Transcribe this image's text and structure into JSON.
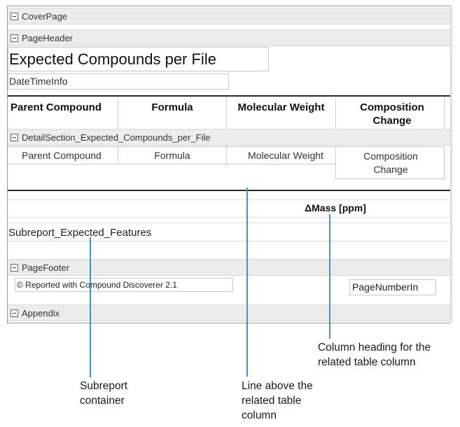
{
  "bands": {
    "cover_page": "CoverPage",
    "page_header": "PageHeader",
    "detail_section": "DetailSection_Expected_Compounds_per_File",
    "page_footer": "PageFooter",
    "appendix": "Appendix"
  },
  "header": {
    "title": "Expected Compounds per File",
    "datetime": "DateTimeInfo"
  },
  "table_headers": [
    "Parent Compound",
    "Formula",
    "Molecular Weight",
    "Composition Change"
  ],
  "detail_cells": [
    "Parent Compound",
    "Formula",
    "Molecular Weight",
    "Composition Change"
  ],
  "subheader": {
    "delta_mass": "ΔMass [ppm]"
  },
  "subreport": "Subreport_Expected_Features",
  "footer": {
    "reported_with": "© Reported with Compound Discoverer 2.1",
    "page_number": "PageNumberIn"
  },
  "callouts": {
    "column_heading": [
      "Column heading for the",
      "related table column"
    ],
    "subreport_container": [
      "Subreport",
      "container"
    ],
    "line_above": [
      "Line above the",
      "related table",
      "column"
    ]
  },
  "colors": {
    "callout_line": "#4a90c8",
    "band_background": "#ececec"
  }
}
